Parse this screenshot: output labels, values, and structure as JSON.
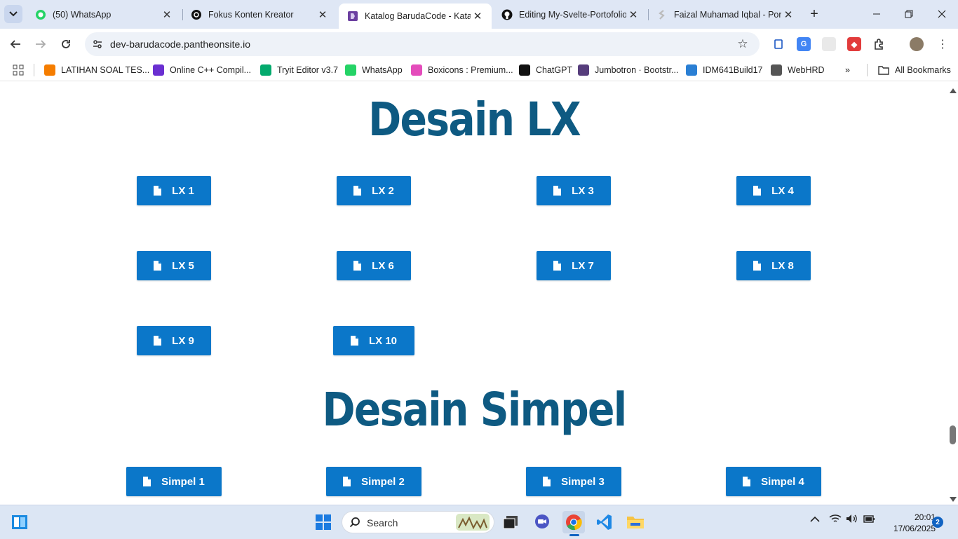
{
  "tabs": [
    {
      "title": "(50) WhatsApp",
      "icon": "whatsapp-icon"
    },
    {
      "title": "Fokus Konten Kreator",
      "icon": "openai-icon"
    },
    {
      "title": "Katalog BarudaCode - Katalog",
      "icon": "barudacode-icon",
      "active": true
    },
    {
      "title": "Editing My-Svelte-Portofolio",
      "icon": "github-icon"
    },
    {
      "title": "Faizal Muhamad Iqbal - Portofolio",
      "icon": "svelte-icon"
    }
  ],
  "address_bar": {
    "url": "dev-barudacode.pantheonsite.io"
  },
  "bookmarks": [
    {
      "label": "LATIHAN SOAL TES...",
      "icon": "blogger-icon",
      "color": "#f57d00"
    },
    {
      "label": "Online C++ Compil...",
      "icon": "lightning-icon",
      "color": "#6a2fd1"
    },
    {
      "label": "Tryit Editor v3.7",
      "icon": "w3schools-icon",
      "color": "#04aa6d"
    },
    {
      "label": "WhatsApp",
      "icon": "whatsapp-icon",
      "color": "#25d366"
    },
    {
      "label": "Boxicons : Premium...",
      "icon": "boxicons-icon",
      "color": "#e44cbb"
    },
    {
      "label": "ChatGPT",
      "icon": "openai-icon",
      "color": "#111111"
    },
    {
      "label": "Jumbotron · Bootstr...",
      "icon": "bootstrap-icon",
      "color": "#563d7c"
    },
    {
      "label": "IDM641Build17",
      "icon": "idm-icon",
      "color": "#2a7fd4"
    },
    {
      "label": "WebHRD",
      "icon": "globe-icon",
      "color": "#555555"
    }
  ],
  "all_bookmarks_label": "All Bookmarks",
  "sections": [
    {
      "title": "Desain LX",
      "buttons": [
        "LX 1",
        "LX 2",
        "LX 3",
        "LX 4",
        "LX 5",
        "LX 6",
        "LX 7",
        "LX 8",
        "LX 9",
        "LX 10"
      ]
    },
    {
      "title": "Desain Simpel",
      "buttons": [
        "Simpel 1",
        "Simpel 2",
        "Simpel 3",
        "Simpel 4"
      ]
    }
  ],
  "taskbar": {
    "search_placeholder": "Search",
    "time": "20:01",
    "date": "17/06/2025",
    "notification_count": "2"
  },
  "colors": {
    "heading": "#0e5a82",
    "button": "#0b77c9",
    "tabstrip": "#dfe7f5"
  }
}
